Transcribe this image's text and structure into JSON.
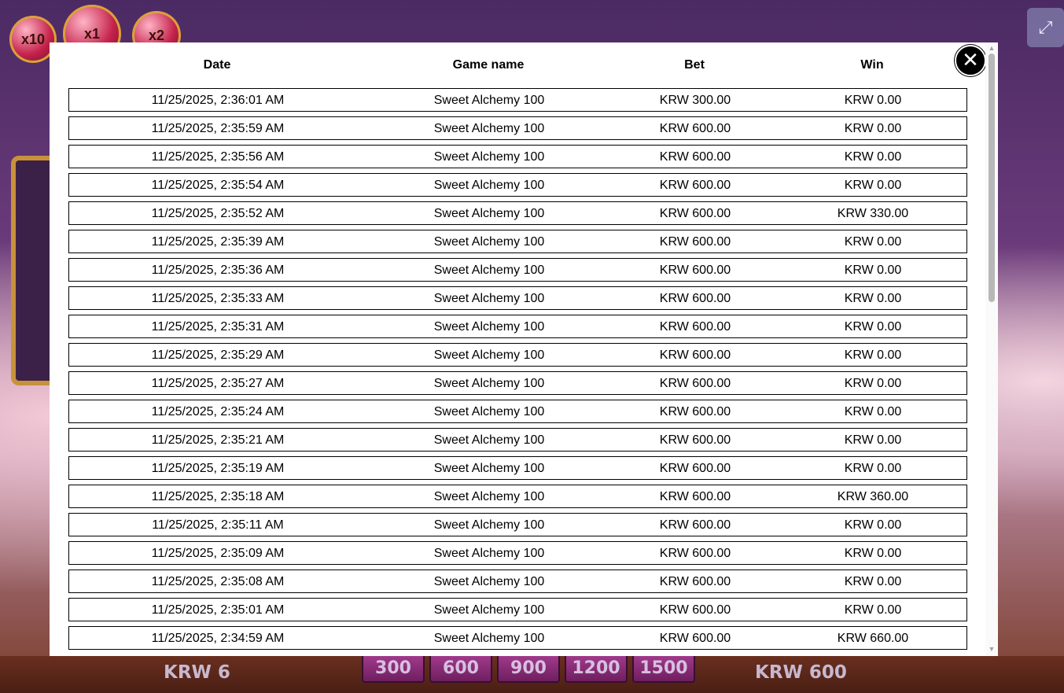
{
  "background": {
    "multipliers": [
      "x10",
      "x1",
      "x2"
    ],
    "coin_label": "KRW 6",
    "bet_label": "KRW 600",
    "bet_options": [
      "300",
      "600",
      "900",
      "1200",
      "1500"
    ]
  },
  "history": {
    "columns": {
      "date": "Date",
      "game": "Game name",
      "bet": "Bet",
      "win": "Win"
    },
    "rows": [
      {
        "date": "11/25/2025, 2:36:01 AM",
        "game": "Sweet Alchemy 100",
        "bet": "KRW 300.00",
        "win": "KRW 0.00"
      },
      {
        "date": "11/25/2025, 2:35:59 AM",
        "game": "Sweet Alchemy 100",
        "bet": "KRW 600.00",
        "win": "KRW 0.00"
      },
      {
        "date": "11/25/2025, 2:35:56 AM",
        "game": "Sweet Alchemy 100",
        "bet": "KRW 600.00",
        "win": "KRW 0.00"
      },
      {
        "date": "11/25/2025, 2:35:54 AM",
        "game": "Sweet Alchemy 100",
        "bet": "KRW 600.00",
        "win": "KRW 0.00"
      },
      {
        "date": "11/25/2025, 2:35:52 AM",
        "game": "Sweet Alchemy 100",
        "bet": "KRW 600.00",
        "win": "KRW 330.00"
      },
      {
        "date": "11/25/2025, 2:35:39 AM",
        "game": "Sweet Alchemy 100",
        "bet": "KRW 600.00",
        "win": "KRW 0.00"
      },
      {
        "date": "11/25/2025, 2:35:36 AM",
        "game": "Sweet Alchemy 100",
        "bet": "KRW 600.00",
        "win": "KRW 0.00"
      },
      {
        "date": "11/25/2025, 2:35:33 AM",
        "game": "Sweet Alchemy 100",
        "bet": "KRW 600.00",
        "win": "KRW 0.00"
      },
      {
        "date": "11/25/2025, 2:35:31 AM",
        "game": "Sweet Alchemy 100",
        "bet": "KRW 600.00",
        "win": "KRW 0.00"
      },
      {
        "date": "11/25/2025, 2:35:29 AM",
        "game": "Sweet Alchemy 100",
        "bet": "KRW 600.00",
        "win": "KRW 0.00"
      },
      {
        "date": "11/25/2025, 2:35:27 AM",
        "game": "Sweet Alchemy 100",
        "bet": "KRW 600.00",
        "win": "KRW 0.00"
      },
      {
        "date": "11/25/2025, 2:35:24 AM",
        "game": "Sweet Alchemy 100",
        "bet": "KRW 600.00",
        "win": "KRW 0.00"
      },
      {
        "date": "11/25/2025, 2:35:21 AM",
        "game": "Sweet Alchemy 100",
        "bet": "KRW 600.00",
        "win": "KRW 0.00"
      },
      {
        "date": "11/25/2025, 2:35:19 AM",
        "game": "Sweet Alchemy 100",
        "bet": "KRW 600.00",
        "win": "KRW 0.00"
      },
      {
        "date": "11/25/2025, 2:35:18 AM",
        "game": "Sweet Alchemy 100",
        "bet": "KRW 600.00",
        "win": "KRW 360.00"
      },
      {
        "date": "11/25/2025, 2:35:11 AM",
        "game": "Sweet Alchemy 100",
        "bet": "KRW 600.00",
        "win": "KRW 0.00"
      },
      {
        "date": "11/25/2025, 2:35:09 AM",
        "game": "Sweet Alchemy 100",
        "bet": "KRW 600.00",
        "win": "KRW 0.00"
      },
      {
        "date": "11/25/2025, 2:35:08 AM",
        "game": "Sweet Alchemy 100",
        "bet": "KRW 600.00",
        "win": "KRW 0.00"
      },
      {
        "date": "11/25/2025, 2:35:01 AM",
        "game": "Sweet Alchemy 100",
        "bet": "KRW 600.00",
        "win": "KRW 0.00"
      },
      {
        "date": "11/25/2025, 2:34:59 AM",
        "game": "Sweet Alchemy 100",
        "bet": "KRW 600.00",
        "win": "KRW 660.00"
      }
    ]
  }
}
